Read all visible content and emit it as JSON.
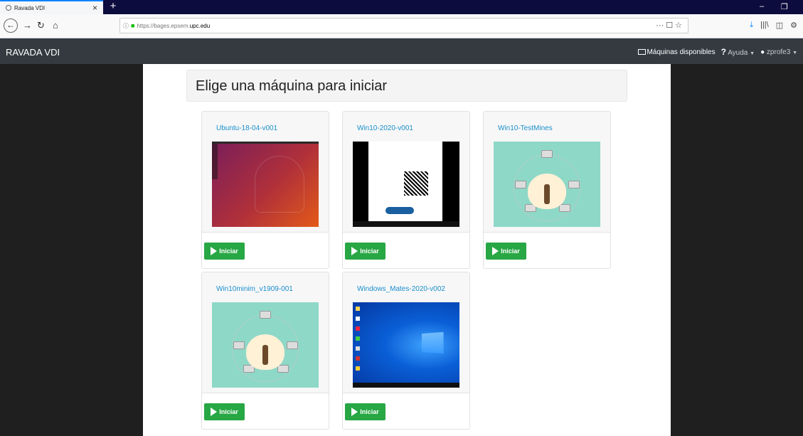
{
  "browser": {
    "tab_title": "Ravada VDI",
    "tab_close": "×",
    "new_tab": "+",
    "url_protocol": "https://",
    "url_subdomain": "bages.epsem.",
    "url_host": "upc.edu",
    "url_actions": "··· ☐ ☆",
    "window_minimize": "–",
    "window_restore": "❐"
  },
  "app": {
    "brand": "RAVADA VDI",
    "nav": {
      "machines": "Máquinas disponibles",
      "help": "Ayuda",
      "user": "zprofe3"
    },
    "page_title": "Elige una máquina para iniciar",
    "start_label": "Iniciar",
    "machines": [
      {
        "name": "Ubuntu-18-04-v001",
        "thumb": "ubuntu-desktop"
      },
      {
        "name": "Win10-2020-v001",
        "thumb": "windows-document"
      },
      {
        "name": "Win10-TestMines",
        "thumb": "ravada-logo"
      },
      {
        "name": "Win10minim_v1909-001",
        "thumb": "ravada-logo"
      },
      {
        "name": "Windows_Mates-2020-v002",
        "thumb": "windows10-desktop"
      }
    ]
  }
}
